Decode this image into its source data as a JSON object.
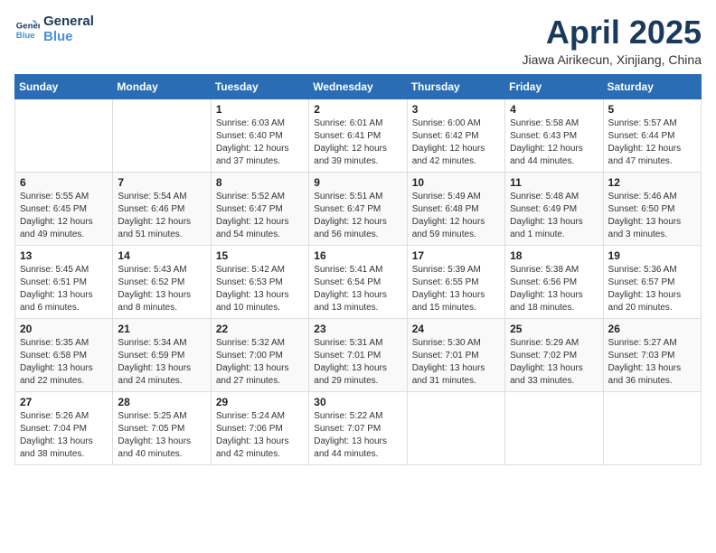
{
  "header": {
    "logo_line1": "General",
    "logo_line2": "Blue",
    "month_title": "April 2025",
    "location": "Jiawa Airikecun, Xinjiang, China"
  },
  "days_of_week": [
    "Sunday",
    "Monday",
    "Tuesday",
    "Wednesday",
    "Thursday",
    "Friday",
    "Saturday"
  ],
  "weeks": [
    [
      {
        "day": "",
        "info": ""
      },
      {
        "day": "",
        "info": ""
      },
      {
        "day": "1",
        "info": "Sunrise: 6:03 AM\nSunset: 6:40 PM\nDaylight: 12 hours and 37 minutes."
      },
      {
        "day": "2",
        "info": "Sunrise: 6:01 AM\nSunset: 6:41 PM\nDaylight: 12 hours and 39 minutes."
      },
      {
        "day": "3",
        "info": "Sunrise: 6:00 AM\nSunset: 6:42 PM\nDaylight: 12 hours and 42 minutes."
      },
      {
        "day": "4",
        "info": "Sunrise: 5:58 AM\nSunset: 6:43 PM\nDaylight: 12 hours and 44 minutes."
      },
      {
        "day": "5",
        "info": "Sunrise: 5:57 AM\nSunset: 6:44 PM\nDaylight: 12 hours and 47 minutes."
      }
    ],
    [
      {
        "day": "6",
        "info": "Sunrise: 5:55 AM\nSunset: 6:45 PM\nDaylight: 12 hours and 49 minutes."
      },
      {
        "day": "7",
        "info": "Sunrise: 5:54 AM\nSunset: 6:46 PM\nDaylight: 12 hours and 51 minutes."
      },
      {
        "day": "8",
        "info": "Sunrise: 5:52 AM\nSunset: 6:47 PM\nDaylight: 12 hours and 54 minutes."
      },
      {
        "day": "9",
        "info": "Sunrise: 5:51 AM\nSunset: 6:47 PM\nDaylight: 12 hours and 56 minutes."
      },
      {
        "day": "10",
        "info": "Sunrise: 5:49 AM\nSunset: 6:48 PM\nDaylight: 12 hours and 59 minutes."
      },
      {
        "day": "11",
        "info": "Sunrise: 5:48 AM\nSunset: 6:49 PM\nDaylight: 13 hours and 1 minute."
      },
      {
        "day": "12",
        "info": "Sunrise: 5:46 AM\nSunset: 6:50 PM\nDaylight: 13 hours and 3 minutes."
      }
    ],
    [
      {
        "day": "13",
        "info": "Sunrise: 5:45 AM\nSunset: 6:51 PM\nDaylight: 13 hours and 6 minutes."
      },
      {
        "day": "14",
        "info": "Sunrise: 5:43 AM\nSunset: 6:52 PM\nDaylight: 13 hours and 8 minutes."
      },
      {
        "day": "15",
        "info": "Sunrise: 5:42 AM\nSunset: 6:53 PM\nDaylight: 13 hours and 10 minutes."
      },
      {
        "day": "16",
        "info": "Sunrise: 5:41 AM\nSunset: 6:54 PM\nDaylight: 13 hours and 13 minutes."
      },
      {
        "day": "17",
        "info": "Sunrise: 5:39 AM\nSunset: 6:55 PM\nDaylight: 13 hours and 15 minutes."
      },
      {
        "day": "18",
        "info": "Sunrise: 5:38 AM\nSunset: 6:56 PM\nDaylight: 13 hours and 18 minutes."
      },
      {
        "day": "19",
        "info": "Sunrise: 5:36 AM\nSunset: 6:57 PM\nDaylight: 13 hours and 20 minutes."
      }
    ],
    [
      {
        "day": "20",
        "info": "Sunrise: 5:35 AM\nSunset: 6:58 PM\nDaylight: 13 hours and 22 minutes."
      },
      {
        "day": "21",
        "info": "Sunrise: 5:34 AM\nSunset: 6:59 PM\nDaylight: 13 hours and 24 minutes."
      },
      {
        "day": "22",
        "info": "Sunrise: 5:32 AM\nSunset: 7:00 PM\nDaylight: 13 hours and 27 minutes."
      },
      {
        "day": "23",
        "info": "Sunrise: 5:31 AM\nSunset: 7:01 PM\nDaylight: 13 hours and 29 minutes."
      },
      {
        "day": "24",
        "info": "Sunrise: 5:30 AM\nSunset: 7:01 PM\nDaylight: 13 hours and 31 minutes."
      },
      {
        "day": "25",
        "info": "Sunrise: 5:29 AM\nSunset: 7:02 PM\nDaylight: 13 hours and 33 minutes."
      },
      {
        "day": "26",
        "info": "Sunrise: 5:27 AM\nSunset: 7:03 PM\nDaylight: 13 hours and 36 minutes."
      }
    ],
    [
      {
        "day": "27",
        "info": "Sunrise: 5:26 AM\nSunset: 7:04 PM\nDaylight: 13 hours and 38 minutes."
      },
      {
        "day": "28",
        "info": "Sunrise: 5:25 AM\nSunset: 7:05 PM\nDaylight: 13 hours and 40 minutes."
      },
      {
        "day": "29",
        "info": "Sunrise: 5:24 AM\nSunset: 7:06 PM\nDaylight: 13 hours and 42 minutes."
      },
      {
        "day": "30",
        "info": "Sunrise: 5:22 AM\nSunset: 7:07 PM\nDaylight: 13 hours and 44 minutes."
      },
      {
        "day": "",
        "info": ""
      },
      {
        "day": "",
        "info": ""
      },
      {
        "day": "",
        "info": ""
      }
    ]
  ]
}
